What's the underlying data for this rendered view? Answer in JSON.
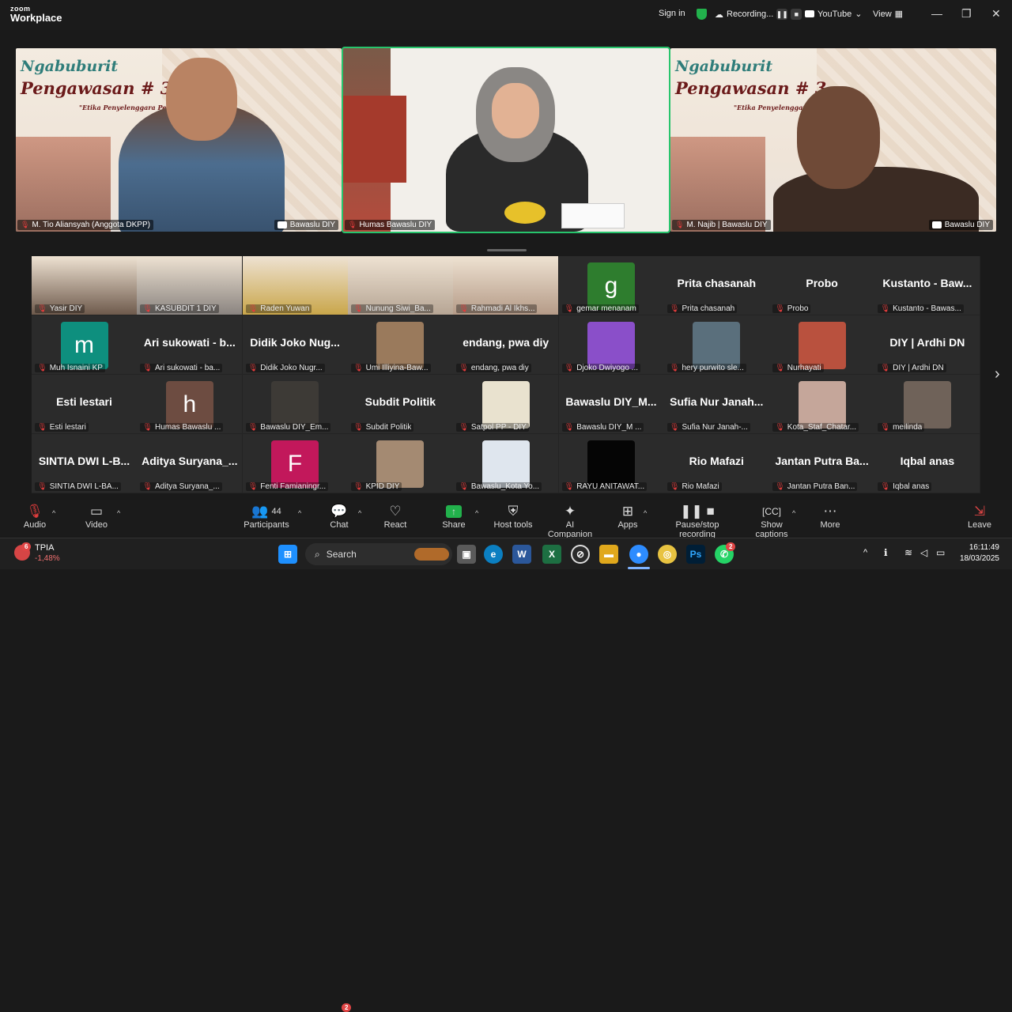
{
  "app": {
    "logo_top": "zoom",
    "logo_bottom": "Workplace"
  },
  "titlebar": {
    "signin": "Sign in",
    "recording": "Recording...",
    "youtube": "YouTube",
    "view": "View"
  },
  "banner": {
    "title1": "Ngabuburit",
    "title2": "Pengawasan # 3",
    "subtitle": "\"Etika Penyelenggara Pemil"
  },
  "speakers": [
    {
      "name": "M. Tio Aliansyah (Anggota DKPP)",
      "yt": "Bawaslu DIY"
    },
    {
      "name": "Humas Bawaslu DIY",
      "yt": ""
    },
    {
      "name": "M. Najib | Bawaslu DIY",
      "yt": "Bawaslu DIY"
    }
  ],
  "gallery": [
    {
      "kind": "video",
      "name": "Yasir DIY",
      "color": "#6e5a4c"
    },
    {
      "kind": "video",
      "name": "KASUBDIT 1 DIY",
      "color": "#8a8480"
    },
    {
      "kind": "video",
      "name": "Raden Yuwan",
      "color": "#c9a64a"
    },
    {
      "kind": "video",
      "name": "Nunung Siwi_Ba...",
      "color": "#b6a594"
    },
    {
      "kind": "video",
      "name": "Rahmadi Al Ikhs...",
      "color": "#b59b88"
    },
    {
      "kind": "avatar",
      "letter": "g",
      "bg": "#2e7d2e",
      "name": "gemar menanam"
    },
    {
      "kind": "text",
      "big": "Prita chasanah",
      "name": "Prita chasanah"
    },
    {
      "kind": "text",
      "big": "Probo",
      "name": "Probo"
    },
    {
      "kind": "text",
      "big": "Kustanto - Baw...",
      "name": "Kustanto - Bawas..."
    },
    {
      "kind": "avatar",
      "letter": "m",
      "bg": "#0e8f7e",
      "name": "Muh Isnaini KP"
    },
    {
      "kind": "text",
      "big": "Ari sukowati - b...",
      "name": "Ari sukowati - ba..."
    },
    {
      "kind": "text",
      "big": "Didik Joko Nug...",
      "name": "Didik Joko Nugr..."
    },
    {
      "kind": "photo",
      "color": "#9a7a5c",
      "name": "Umi Illiyina-Baw..."
    },
    {
      "kind": "text",
      "big": "endang, pwa diy",
      "name": "endang, pwa diy"
    },
    {
      "kind": "photo",
      "color": "#8a4fc9",
      "name": "Djoko Dwiyogo ..."
    },
    {
      "kind": "photo",
      "color": "#5a6f7c",
      "name": "hery purwito sle..."
    },
    {
      "kind": "photo",
      "color": "#b9513e",
      "name": "Nurhayati"
    },
    {
      "kind": "text",
      "big": "DIY | Ardhi DN",
      "name": "DIY | Ardhi DN"
    },
    {
      "kind": "text",
      "big": "Esti lestari",
      "name": "Esti lestari"
    },
    {
      "kind": "avatar",
      "letter": "h",
      "bg": "#6d4c41",
      "name": "Humas Bawaslu ..."
    },
    {
      "kind": "photo",
      "color": "#3d3a36",
      "name": "Bawaslu DIY_Em..."
    },
    {
      "kind": "text",
      "big": "Subdit Politik",
      "name": "Subdit Politik"
    },
    {
      "kind": "photo",
      "color": "#e9e2cf",
      "name": "Satpol PP - DIY"
    },
    {
      "kind": "text",
      "big": "Bawaslu DIY_M...",
      "name": "Bawaslu DIY_M ..."
    },
    {
      "kind": "text",
      "big": "Sufia Nur Janah...",
      "name": "Sufia Nur Janah-..."
    },
    {
      "kind": "photo",
      "color": "#c5a69a",
      "name": "Kota_Staf_Chatar..."
    },
    {
      "kind": "photo",
      "color": "#6f6259",
      "name": "meilinda"
    },
    {
      "kind": "text",
      "big": "SINTIA DWI L-B...",
      "name": "SINTIA DWI L-BA..."
    },
    {
      "kind": "text",
      "big": "Aditya Suryana_...",
      "name": "Aditya Suryana_..."
    },
    {
      "kind": "avatar",
      "letter": "F",
      "bg": "#c2185b",
      "name": "Fenti Famianingr..."
    },
    {
      "kind": "photo",
      "color": "#a48a72",
      "name": "KPID DIY"
    },
    {
      "kind": "photo",
      "color": "#dfe6ee",
      "name": "Bawaslu_Kota Yo..."
    },
    {
      "kind": "photo",
      "color": "#050505",
      "name": "RAYU ANITAWAT..."
    },
    {
      "kind": "text",
      "big": "Rio Mafazi",
      "name": "Rio Mafazi"
    },
    {
      "kind": "text",
      "big": "Jantan Putra Ba...",
      "name": "Jantan Putra Ban..."
    },
    {
      "kind": "text",
      "big": "Iqbal anas",
      "name": "Iqbal anas"
    }
  ],
  "toolbar": {
    "audio": "Audio",
    "video": "Video",
    "participants": "Participants",
    "participants_count": "44",
    "chat": "Chat",
    "chat_badge": "2",
    "react": "React",
    "share": "Share",
    "host_tools": "Host tools",
    "ai": "AI Companion",
    "apps": "Apps",
    "pause_rec": "Pause/stop recording",
    "captions": "Show captions",
    "more": "More",
    "leave": "Leave"
  },
  "taskbar": {
    "stock_name": "TPIA",
    "stock_change": "-1,48%",
    "stock_badge": "6",
    "search": "Search",
    "whatsapp_badge": "2",
    "time": "16:11:49",
    "date": "18/03/2025"
  },
  "colors": {
    "active_border": "#27c46c",
    "mute": "#e23c3c",
    "share_green": "#22b14c"
  }
}
